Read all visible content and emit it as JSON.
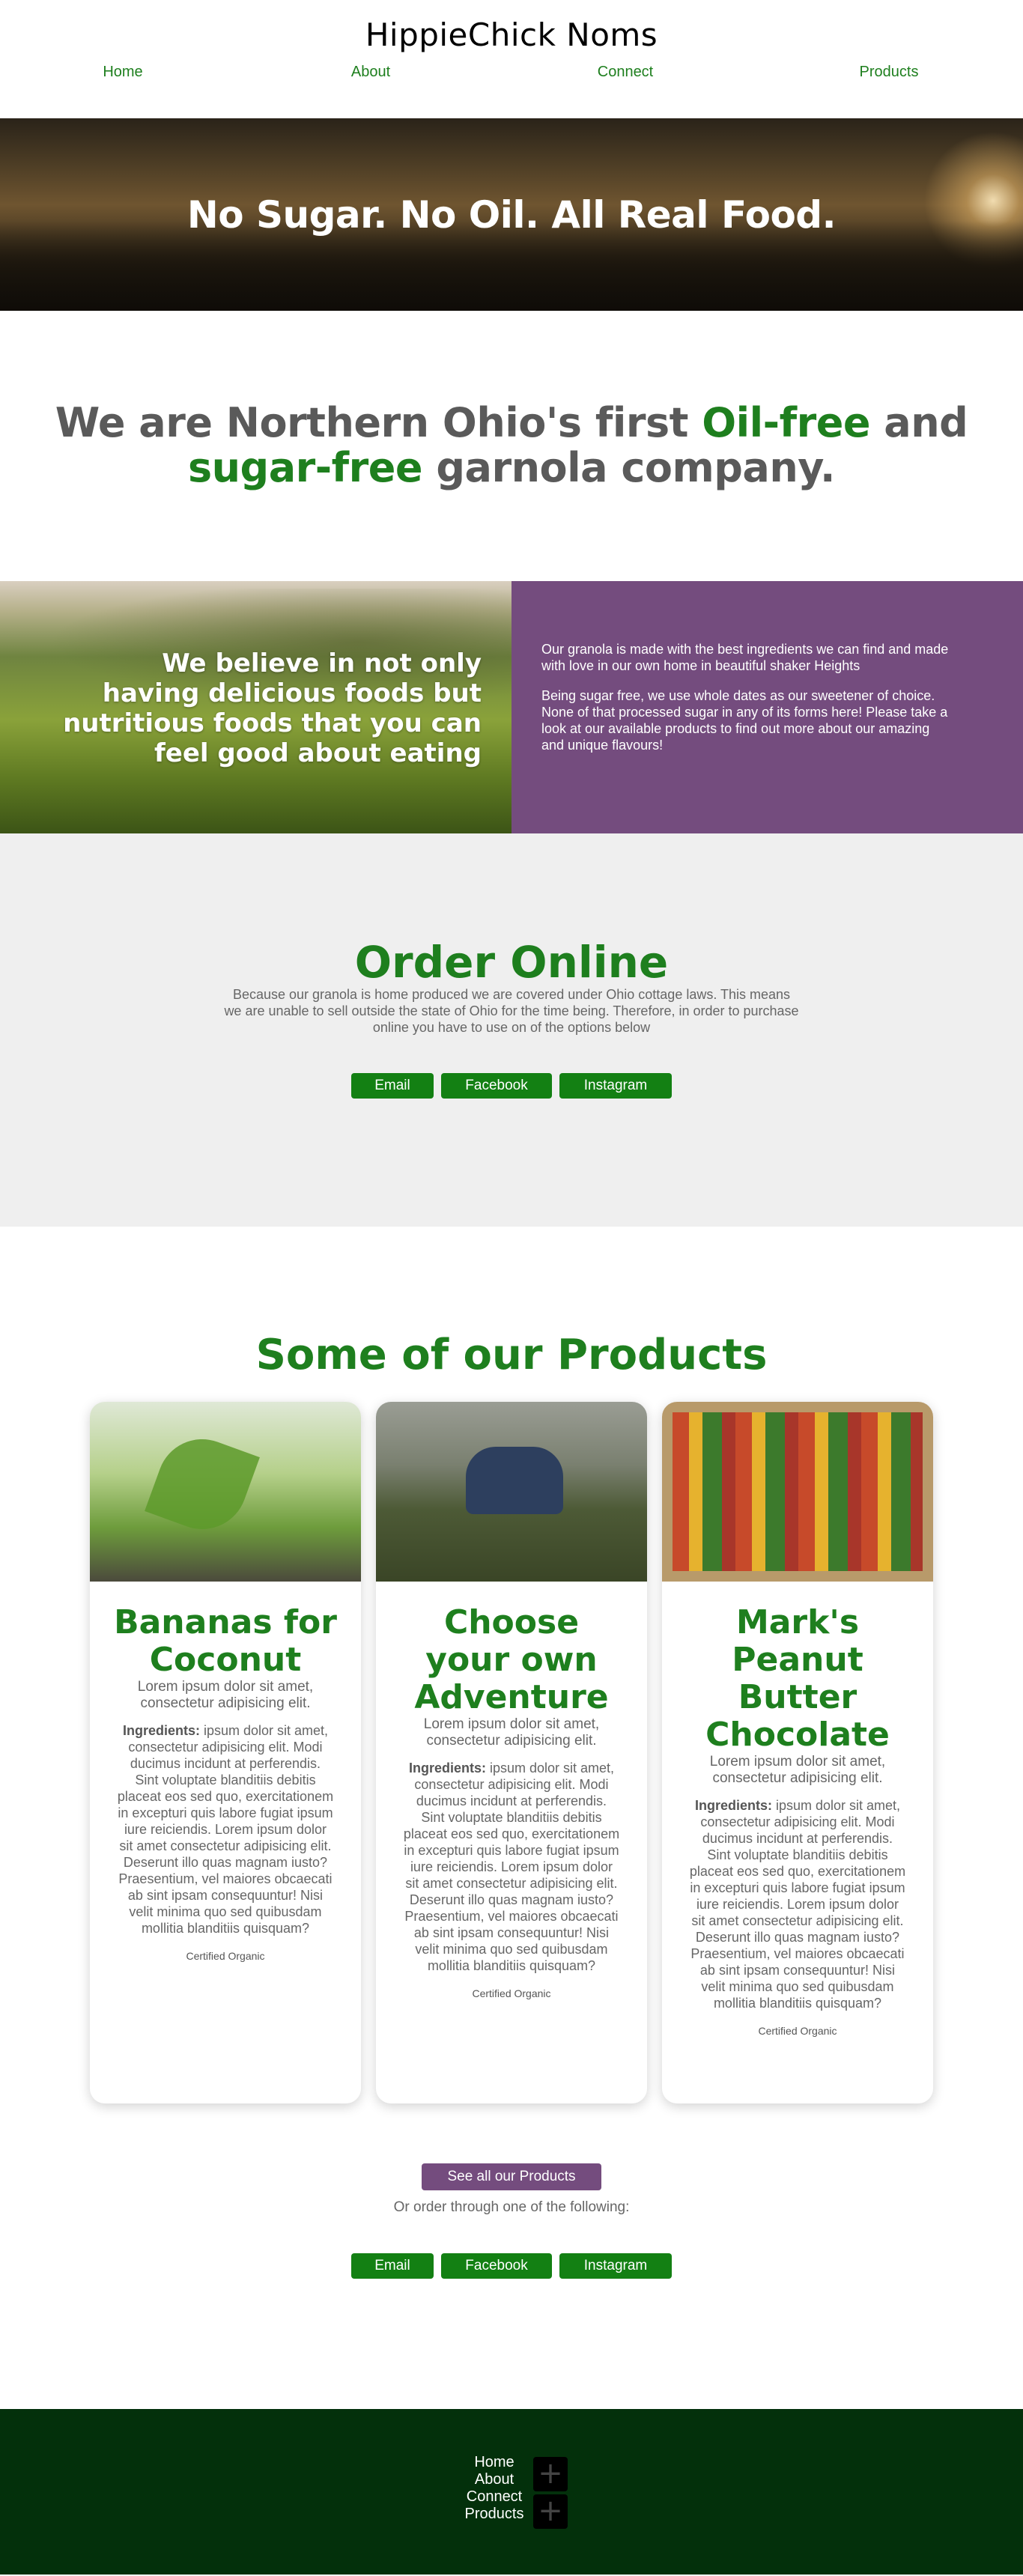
{
  "brand": "HippieChick Noms",
  "nav": [
    "Home",
    "About",
    "Connect",
    "Products"
  ],
  "hero": {
    "title": "No Sugar. No Oil. All Real Food."
  },
  "intro": {
    "part1": "We are Northern Ohio's first ",
    "green1": "Oil-free",
    "part2": " and ",
    "green2": "sugar-free",
    "part3": " garnola company."
  },
  "split": {
    "left": "We believe in not only having delicious foods but nutritious foods that you can feel good about eating",
    "right_p1": "Our granola is made with the best ingredients we can find and made with love in our own home in beautiful shaker Heights",
    "right_p2": "Being sugar free, we use whole dates as our sweetener of choice. None of that processed sugar in any of its forms here! Please take a look at our available products to find out more about our amazing and unique flavours!"
  },
  "order": {
    "title": "Order Online",
    "text": "Because our granola is home produced we are covered under Ohio cottage laws. This means we are unable to sell outside the state of Ohio for the time being. Therefore, in order to purchase online you have to use on of the options below",
    "buttons": {
      "email": "Email",
      "facebook": "Facebook",
      "instagram": "Instagram"
    }
  },
  "products": {
    "title": "Some of our Products",
    "cards": [
      {
        "title": "Bananas for Coconut",
        "sub": "Lorem ipsum dolor sit amet, consectetur adipisicing elit.",
        "ingredients_label": "Ingredients:",
        "ingredients": " ipsum dolor sit amet, consectetur adipisicing elit. Modi ducimus incidunt at perferendis. Sint voluptate blanditiis debitis placeat eos sed quo, exercitationem in excepturi quis labore fugiat ipsum iure reiciendis. Lorem ipsum dolor sit amet consectetur adipisicing elit. Deserunt illo quas magnam iusto? Praesentium, vel maiores obcaecati ab sint ipsam consequuntur! Nisi velit minima quo sed quibusdam mollitia blanditiis quisquam?",
        "cert": "Certified Organic"
      },
      {
        "title": "Choose your own Adventure",
        "sub": "Lorem ipsum dolor sit amet, consectetur adipisicing elit.",
        "ingredients_label": "Ingredients:",
        "ingredients": " ipsum dolor sit amet, consectetur adipisicing elit. Modi ducimus incidunt at perferendis. Sint voluptate blanditiis debitis placeat eos sed quo, exercitationem in excepturi quis labore fugiat ipsum iure reiciendis. Lorem ipsum dolor sit amet consectetur adipisicing elit. Deserunt illo quas magnam iusto? Praesentium, vel maiores obcaecati ab sint ipsam consequuntur! Nisi velit minima quo sed quibusdam mollitia blanditiis quisquam?",
        "cert": "Certified Organic"
      },
      {
        "title": "Mark's Peanut Butter Chocolate",
        "sub": "Lorem ipsum dolor sit amet, consectetur adipisicing elit.",
        "ingredients_label": "Ingredients:",
        "ingredients": " ipsum dolor sit amet, consectetur adipisicing elit. Modi ducimus incidunt at perferendis. Sint voluptate blanditiis debitis placeat eos sed quo, exercitationem in excepturi quis labore fugiat ipsum iure reiciendis. Lorem ipsum dolor sit amet consectetur adipisicing elit. Deserunt illo quas magnam iusto? Praesentium, vel maiores obcaecati ab sint ipsam consequuntur! Nisi velit minima quo sed quibusdam mollitia blanditiis quisquam?",
        "cert": "Certified Organic"
      }
    ],
    "see_all": "See all our Products",
    "or_text": "Or order through one of the following:",
    "buttons": {
      "email": "Email",
      "facebook": "Facebook",
      "instagram": "Instagram"
    }
  },
  "footer": {
    "nav": [
      "Home",
      "About",
      "Connect",
      "Products"
    ],
    "social_icons": [
      "plus-icon",
      "plus-icon"
    ]
  },
  "colors": {
    "green": "#1e7f1e",
    "button_green": "#138013",
    "purple": "#744c7e",
    "footer": "#03300b",
    "order_bg": "#efefef"
  }
}
